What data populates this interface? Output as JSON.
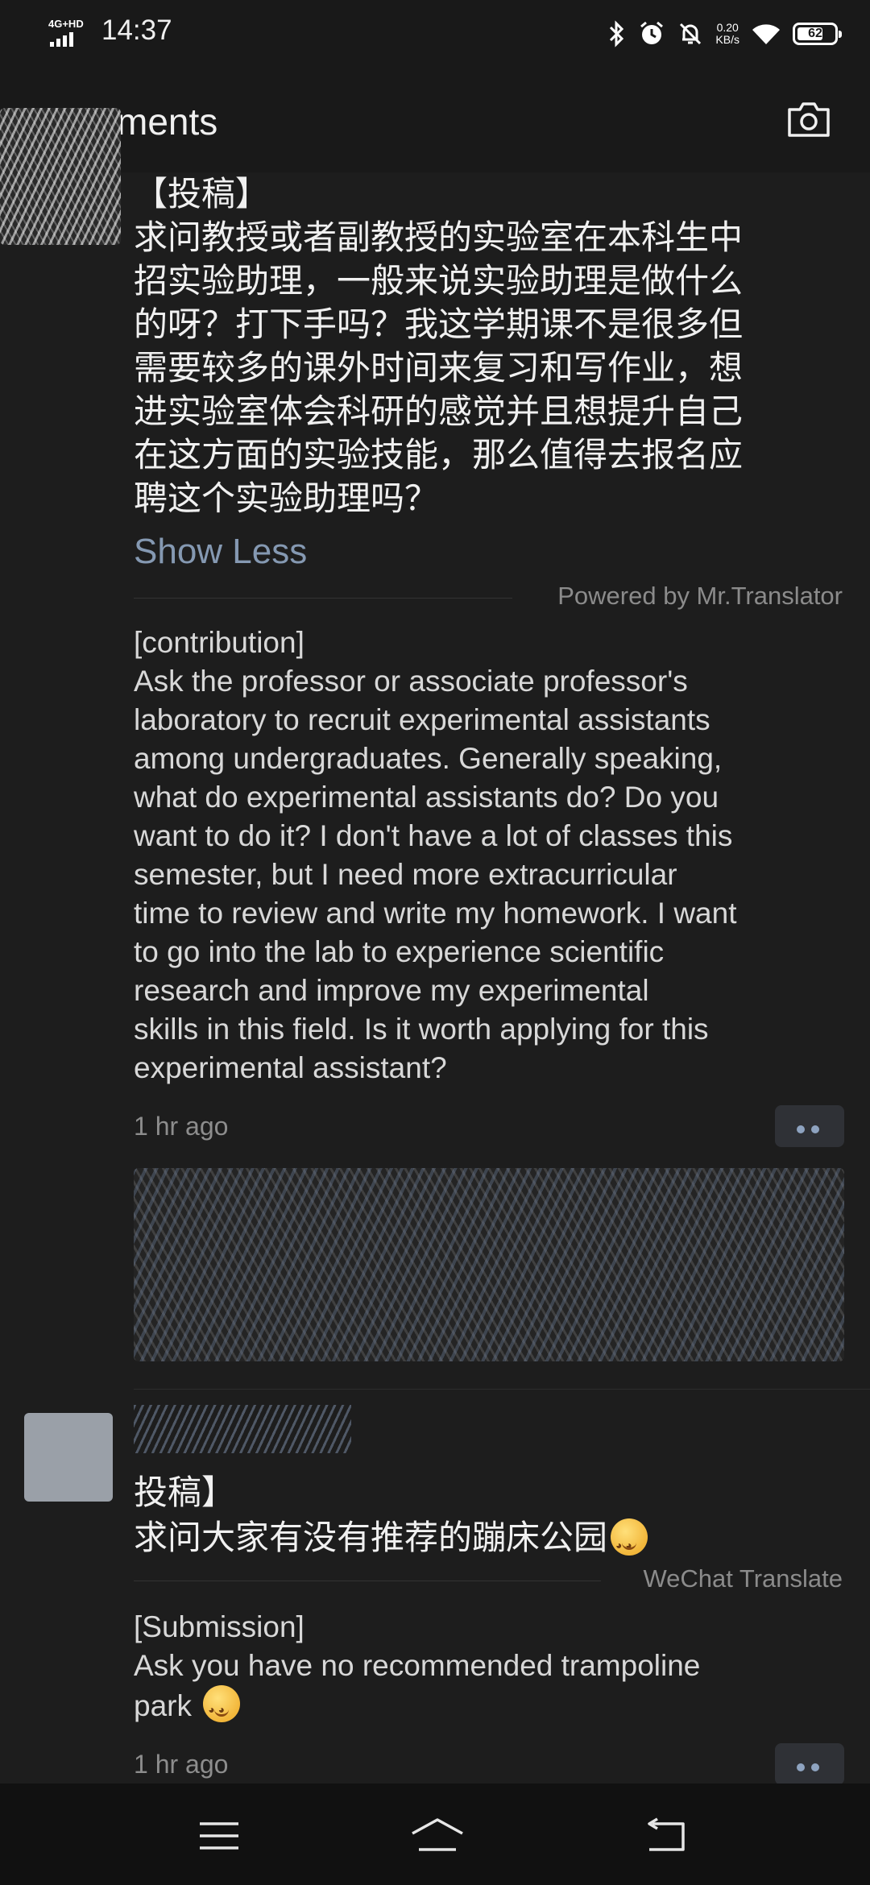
{
  "status_bar": {
    "network": "4G+HD",
    "time": "14:37",
    "speed_value": "0.20",
    "speed_unit": "KB/s",
    "battery": "62",
    "battery_level_percent": 62,
    "icons": [
      "bluetooth-icon",
      "alarm-icon",
      "bell-off-icon",
      "wifi-icon",
      "battery-icon"
    ]
  },
  "header": {
    "title": "ments",
    "camera_icon": "camera-icon"
  },
  "post1": {
    "zh_lines": [
      "【投稿】",
      "求问教授或者副教授的实验室在本科生中",
      "招实验助理，一般来说实验助理是做什么",
      "的呀？打下手吗？我这学期课不是很多但",
      "需要较多的课外时间来复习和写作业，想",
      "进实验室体会科研的感觉并且想提升自己",
      "在这方面的实验技能，那么值得去报名应",
      "聘这个实验助理吗？"
    ],
    "show_less": "Show Less",
    "translation_source": "Powered by Mr.Translator",
    "en_lines": [
      "[contribution]",
      "Ask the professor or associate professor's",
      "laboratory to recruit experimental assistants",
      "among undergraduates. Generally speaking,",
      "what do experimental assistants do? Do you",
      "want to do it? I don't have a lot of classes this",
      "semester, but I need more extracurricular",
      "time to review and write my homework. I want",
      "to go into the lab to experience scientific",
      "research and improve my experimental",
      "skills in this field. Is it worth applying for this",
      "experimental assistant?"
    ],
    "time": "1 hr ago"
  },
  "post2": {
    "zh_header": "投稿】",
    "zh_text": "求问大家有没有推荐的蹦床公园",
    "translation_source": "WeChat Translate",
    "en_header": "[Submission]",
    "en_line1": "Ask you have no recommended trampoline",
    "en_line2": "park",
    "time": "1 hr ago"
  },
  "colors": {
    "background": "#191919",
    "link": "#8599b2",
    "more_button": "#2f3136",
    "dots": "#8ea3c0"
  },
  "nav": {
    "icons": [
      "menu-icon",
      "home-icon",
      "back-icon"
    ]
  }
}
